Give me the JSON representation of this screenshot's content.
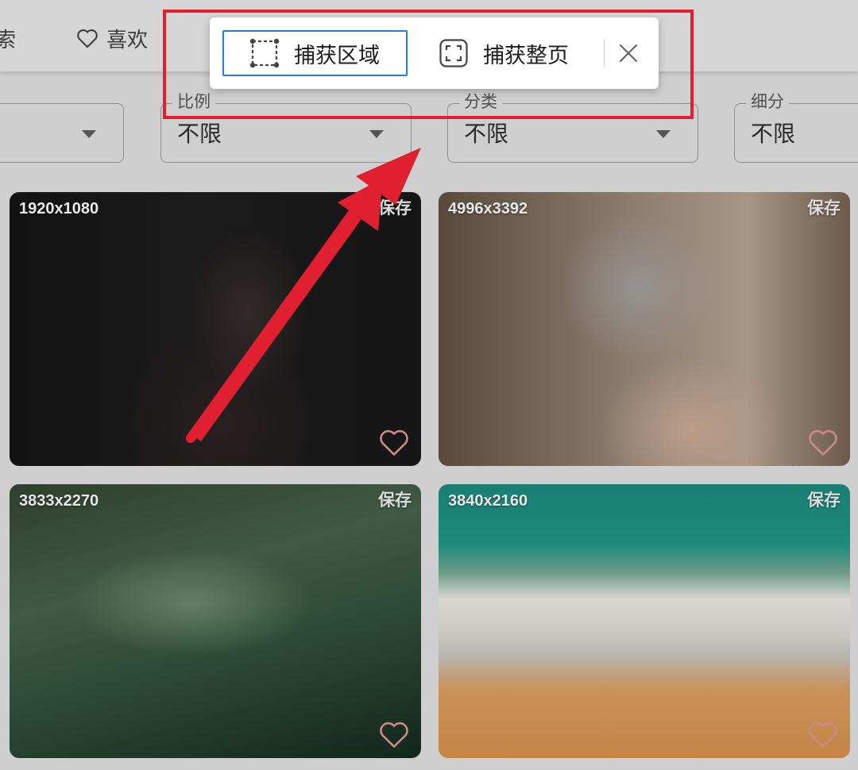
{
  "nav": {
    "search_label": "索",
    "favorites_label": "喜欢"
  },
  "filters": [
    {
      "label": "",
      "value": ""
    },
    {
      "label": "比例",
      "value": "不限"
    },
    {
      "label": "分类",
      "value": "不限"
    },
    {
      "label": "细分",
      "value": "不限"
    }
  ],
  "cards": [
    {
      "resolution": "1920x1080",
      "save_label": "保存"
    },
    {
      "resolution": "4996x3392",
      "save_label": "保存"
    },
    {
      "resolution": "3833x2270",
      "save_label": "保存"
    },
    {
      "resolution": "3840x2160",
      "save_label": "保存"
    }
  ],
  "capture_toolbar": {
    "capture_area_label": "捕获区域",
    "capture_page_label": "捕获整页",
    "close_icon": "close-icon",
    "accent_color": "#1f7fd6"
  },
  "annotation": {
    "color": "#e02030"
  }
}
